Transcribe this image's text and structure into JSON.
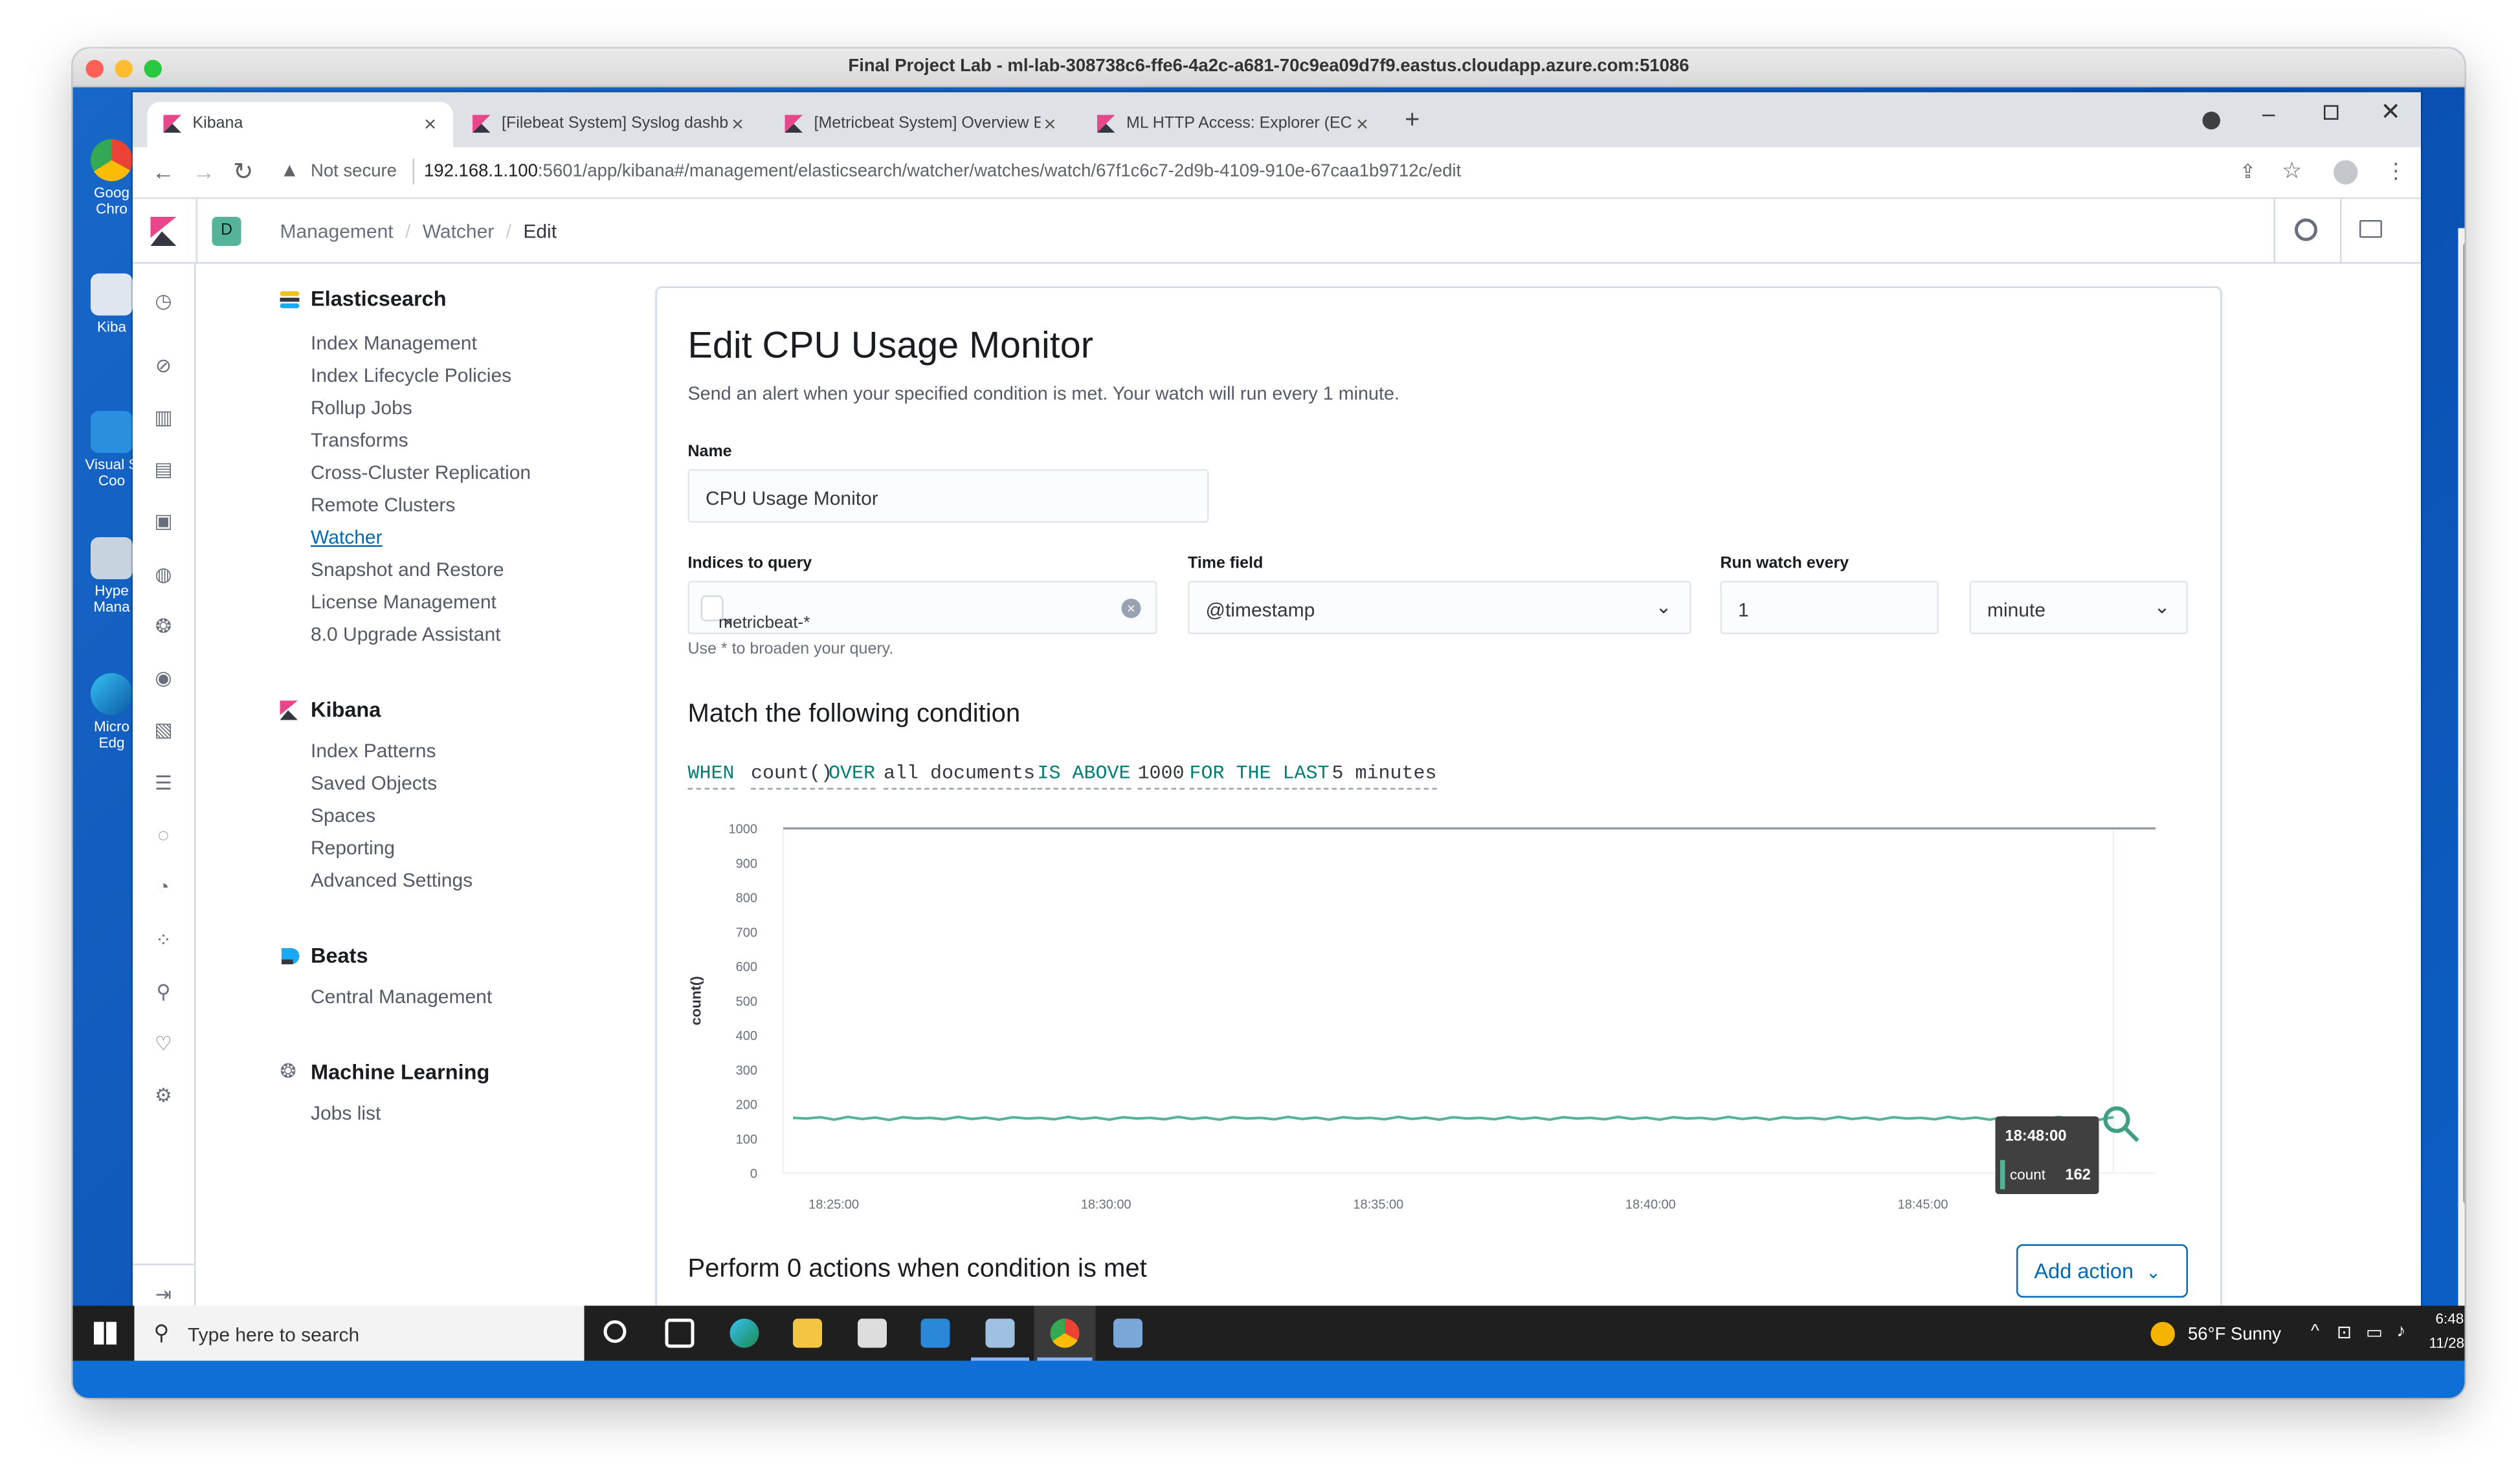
{
  "mac": {
    "window_title": "Final Project Lab - ml-lab-308738c6-ffe6-4a2c-a681-70c9ea09d7f9.eastus.cloudapp.azure.com:51086"
  },
  "desktop_icons": [
    {
      "label": "Goog Chro",
      "icon": "chrome-icon"
    },
    {
      "label": "Kiba",
      "icon": "kibana-shortcut-icon"
    },
    {
      "label": "Visual S Coo",
      "icon": "vscode-icon"
    },
    {
      "label": "Hype Mana",
      "icon": "hyperv-icon"
    },
    {
      "label": "Micro Edg",
      "icon": "edge-icon"
    }
  ],
  "browser": {
    "tabs": [
      {
        "title": "Kibana"
      },
      {
        "title": "[Filebeat System] Syslog dashboa"
      },
      {
        "title": "[Metricbeat System] Overview EC"
      },
      {
        "title": "ML HTTP Access: Explorer (ECS) -"
      }
    ],
    "security": "Not secure",
    "url_host": "192.168.1.100",
    "url_rest": ":5601/app/kibana#/management/elasticsearch/watcher/watches/watch/67f1c6c7-2d9b-4109-910e-67caa1b9712c/edit"
  },
  "header": {
    "space_initial": "D",
    "breadcrumbs": [
      "Management",
      "Watcher",
      "Edit"
    ]
  },
  "sidebar": {
    "elasticsearch": {
      "title": "Elasticsearch",
      "items": [
        "Index Management",
        "Index Lifecycle Policies",
        "Rollup Jobs",
        "Transforms",
        "Cross-Cluster Replication",
        "Remote Clusters",
        "Watcher",
        "Snapshot and Restore",
        "License Management",
        "8.0 Upgrade Assistant"
      ]
    },
    "kibana": {
      "title": "Kibana",
      "items": [
        "Index Patterns",
        "Saved Objects",
        "Spaces",
        "Reporting",
        "Advanced Settings"
      ]
    },
    "beats": {
      "title": "Beats",
      "items": [
        "Central Management"
      ]
    },
    "ml": {
      "title": "Machine Learning",
      "items": [
        "Jobs list"
      ]
    }
  },
  "form": {
    "title": "Edit CPU Usage Monitor",
    "subtitle": "Send an alert when your specified condition is met. Your watch will run every 1 minute.",
    "name_label": "Name",
    "name_value": "CPU Usage Monitor",
    "indices_label": "Indices to query",
    "indices_chip": "metricbeat-*",
    "indices_help": "Use * to broaden your query.",
    "time_field_label": "Time field",
    "time_field_value": "@timestamp",
    "run_every_label": "Run watch every",
    "run_every_value": "1",
    "run_every_unit": "minute",
    "condition_title": "Match the following condition",
    "condition": {
      "when": "WHEN",
      "agg": "count()",
      "over": "OVER",
      "docs": "all documents",
      "is_above": "IS ABOVE",
      "threshold": "1000",
      "for_last": "FOR THE LAST",
      "window": "5 minutes"
    },
    "actions_title": "Perform 0 actions when condition is met",
    "add_action_label": "Add action"
  },
  "chart_data": {
    "type": "line",
    "ylabel": "count()",
    "ylim": [
      0,
      1000
    ],
    "yticks": [
      "0",
      "100",
      "200",
      "300",
      "400",
      "500",
      "600",
      "700",
      "800",
      "900",
      "1000"
    ],
    "xticks": [
      "18:25:00",
      "18:30:00",
      "18:35:00",
      "18:40:00",
      "18:45:00"
    ],
    "x_range_minutes": [
      24.25,
      48.5
    ],
    "threshold": 1000,
    "series": [
      {
        "values": [
          160,
          158,
          162,
          155,
          163,
          157,
          161,
          154,
          162,
          158,
          160,
          156,
          163,
          157,
          161,
          155,
          162,
          158,
          160,
          156,
          163,
          157,
          161,
          155,
          162,
          158,
          160,
          156,
          163,
          157,
          161,
          155,
          162,
          158,
          160,
          156,
          163,
          157,
          161,
          155,
          162,
          158,
          160,
          156,
          163,
          157,
          161,
          155,
          162,
          158,
          160,
          156,
          163,
          157,
          161,
          155,
          162,
          158,
          160,
          156,
          163,
          157,
          161,
          155,
          162,
          158,
          160,
          156,
          163,
          157,
          161,
          155,
          162,
          158,
          160,
          156,
          163,
          157,
          161,
          155,
          162,
          158,
          160,
          156,
          163,
          157,
          161,
          155,
          162,
          158,
          160,
          156,
          163,
          157,
          161,
          155,
          162
        ]
      }
    ],
    "tooltip": {
      "time": "18:48:00",
      "label": "count",
      "value": "162"
    }
  },
  "taskbar": {
    "search_placeholder": "Type here to search",
    "weather": "56°F  Sunny",
    "time": "6:48",
    "date": "11/28"
  }
}
